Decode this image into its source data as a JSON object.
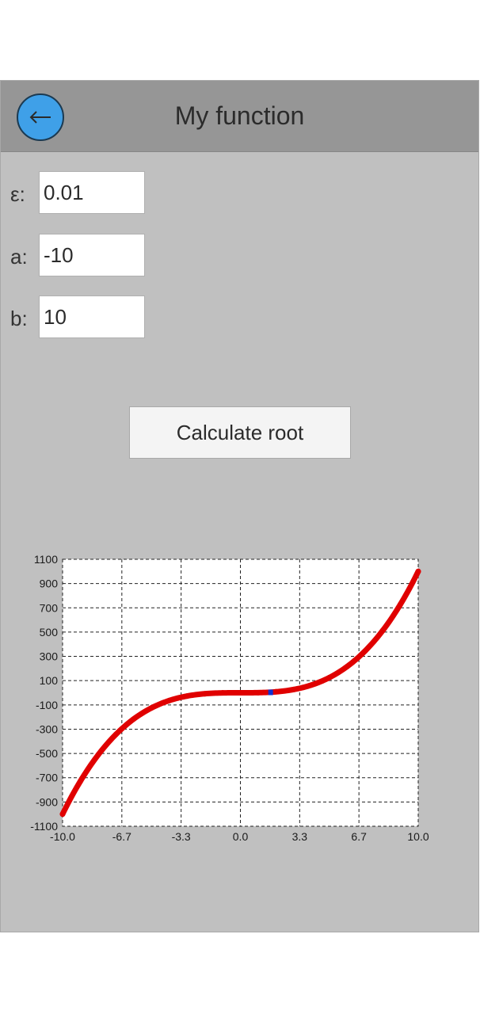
{
  "header": {
    "title": "My function",
    "back_icon": "arrow-left-icon"
  },
  "fields": [
    {
      "label": "ε:",
      "value": "0.01"
    },
    {
      "label": "a:",
      "value": "-10"
    },
    {
      "label": "b:",
      "value": "10"
    }
  ],
  "action": {
    "label": "Calculate root"
  },
  "colors": {
    "curve": "#e00000",
    "root_marker": "#1030d0",
    "back_button": "#3fa0e8"
  },
  "chart_data": {
    "type": "line",
    "function": "x^3",
    "xlim": [
      -10,
      10
    ],
    "ylim": [
      -1100,
      1100
    ],
    "x_ticks": [
      "-10.0",
      "-6.7",
      "-3.3",
      "0.0",
      "3.3",
      "6.7",
      "10.0"
    ],
    "y_ticks": [
      "1100",
      "900",
      "700",
      "500",
      "300",
      "100",
      "-100",
      "-300",
      "-500",
      "-700",
      "-900",
      "-1100"
    ],
    "grid": true,
    "series": [
      {
        "x": [
          -10,
          -9,
          -8,
          -7,
          -6,
          -5,
          -4,
          -3,
          -2,
          -1,
          0,
          1,
          2,
          3,
          4,
          5,
          6,
          7,
          8,
          9,
          10
        ],
        "y": [
          -1000,
          -729,
          -512,
          -343,
          -216,
          -125,
          -64,
          -27,
          -8,
          -1,
          0,
          1,
          8,
          27,
          64,
          125,
          216,
          343,
          512,
          729,
          1000
        ]
      }
    ],
    "root_marker": {
      "x": 1.7,
      "y": 0
    }
  }
}
